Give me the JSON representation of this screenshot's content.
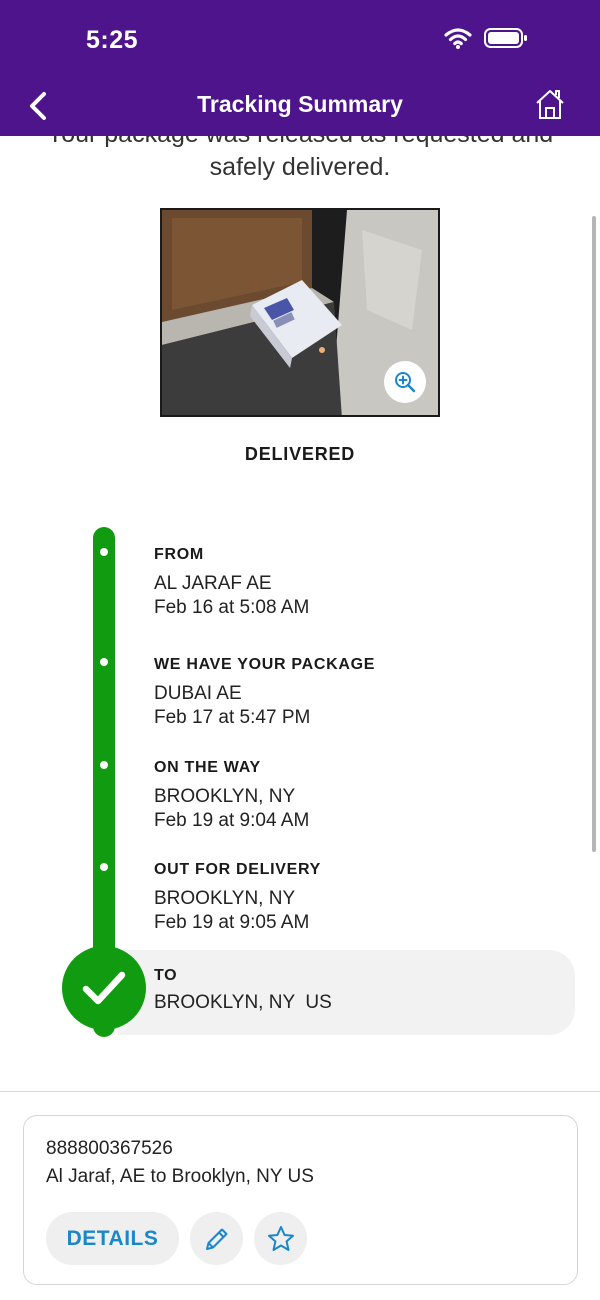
{
  "status_bar": {
    "time": "5:25"
  },
  "nav": {
    "title": "Tracking Summary",
    "back_icon": "chevron-left-icon",
    "home_icon": "home-icon"
  },
  "delivery": {
    "message": "Your package was released as requested and safely delivered.",
    "status": "DELIVERED",
    "photo_alt": "Delivered package photo"
  },
  "timeline": [
    {
      "title": "FROM",
      "lines": [
        "AL JARAF AE",
        "Feb 16 at 5:08 AM"
      ]
    },
    {
      "title": "WE HAVE YOUR PACKAGE",
      "lines": [
        "DUBAI AE",
        "Feb 17 at 5:47 PM"
      ]
    },
    {
      "title": "ON THE WAY",
      "lines": [
        "BROOKLYN, NY",
        "Feb 19 at 9:04 AM"
      ]
    },
    {
      "title": "OUT FOR DELIVERY",
      "lines": [
        "BROOKLYN, NY",
        "Feb 19 at 9:05 AM"
      ]
    }
  ],
  "destination": {
    "title": "TO",
    "city": "BROOKLYN, NY  US"
  },
  "card": {
    "tracking_number": "888800367526",
    "route": "Al Jaraf, AE to Brooklyn, NY US",
    "details_label": "DETAILS"
  },
  "colors": {
    "header": "#4d148c",
    "progress": "#119b11",
    "link": "#1b87c9"
  }
}
